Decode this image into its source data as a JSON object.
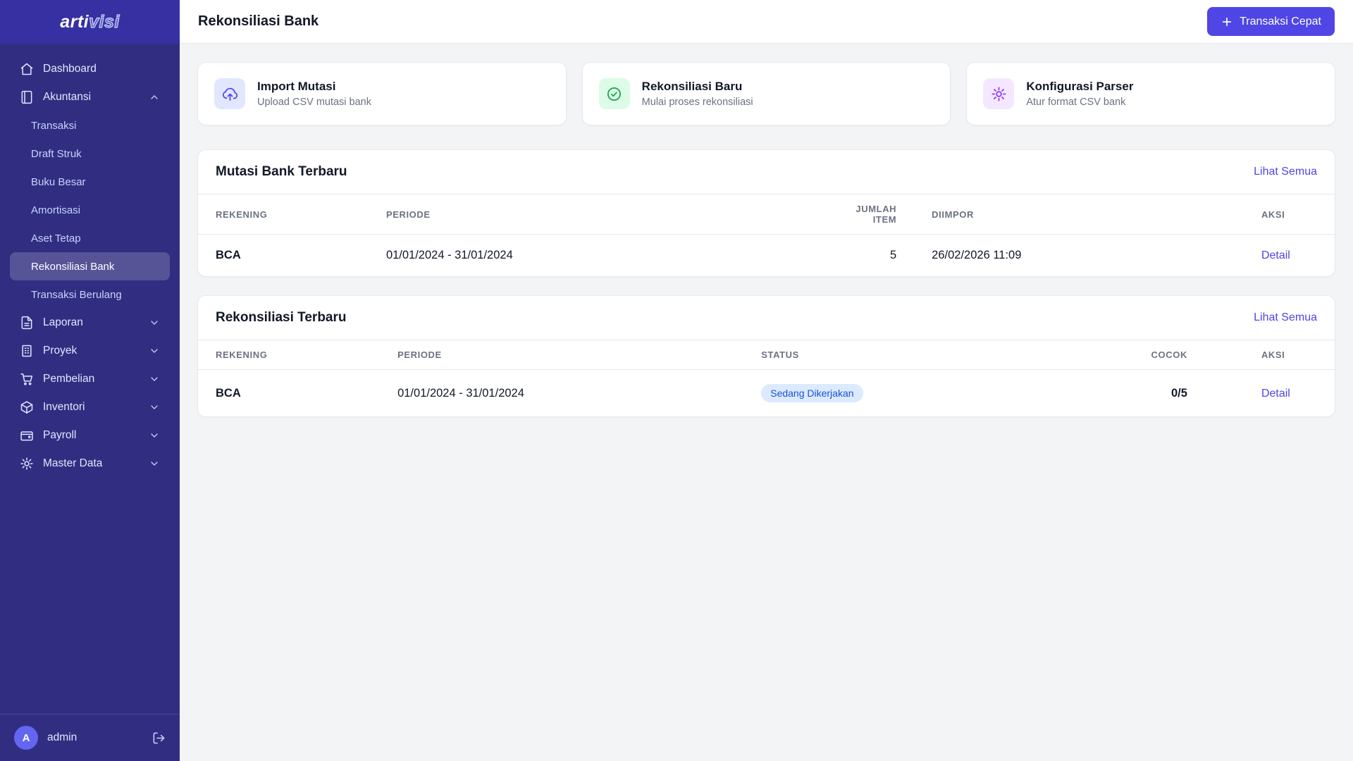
{
  "colors": {
    "sidebar_bg": "#312e81",
    "sidebar_top_bg": "#3730a3",
    "accent": "#4f46e5",
    "badge_bg": "#dbeafe",
    "badge_text": "#1d4ed8",
    "icon_indigo_bg": "#e0e7ff",
    "icon_green_bg": "#dcfce7",
    "icon_purple_bg": "#f3e8ff"
  },
  "sidebar": {
    "logo": {
      "prefix": "arti",
      "suffix": "visi"
    },
    "dashboard": "Dashboard",
    "akuntansi": "Akuntansi",
    "akuntansi_children": [
      "Transaksi",
      "Draft Struk",
      "Buku Besar",
      "Amortisasi",
      "Aset Tetap",
      "Rekonsiliasi Bank",
      "Transaksi Berulang"
    ],
    "groups": [
      "Laporan",
      "Proyek",
      "Pembelian",
      "Inventori",
      "Payroll",
      "Master Data"
    ],
    "user": {
      "initial": "A",
      "name": "admin"
    }
  },
  "header": {
    "title": "Rekonsiliasi Bank",
    "quick_action": "Transaksi Cepat"
  },
  "action_cards": [
    {
      "title": "Import Mutasi",
      "subtitle": "Upload CSV mutasi bank",
      "icon": "cloud-upload-icon"
    },
    {
      "title": "Rekonsiliasi Baru",
      "subtitle": "Mulai proses rekonsiliasi",
      "icon": "check-circle-icon"
    },
    {
      "title": "Konfigurasi Parser",
      "subtitle": "Atur format CSV bank",
      "icon": "gear-icon"
    }
  ],
  "mutasi": {
    "title": "Mutasi Bank Terbaru",
    "view_all": "Lihat Semua",
    "columns": [
      "Rekening",
      "Periode",
      "Jumlah Item",
      "Diimpor",
      "Aksi"
    ],
    "rows": [
      {
        "rekening": "BCA",
        "periode": "01/01/2024 - 31/01/2024",
        "jumlah_item": "5",
        "diimpor": "26/02/2026 11:09",
        "aksi": "Detail"
      }
    ]
  },
  "rekonsiliasi": {
    "title": "Rekonsiliasi Terbaru",
    "view_all": "Lihat Semua",
    "columns": [
      "Rekening",
      "Periode",
      "Status",
      "Cocok",
      "Aksi"
    ],
    "rows": [
      {
        "rekening": "BCA",
        "periode": "01/01/2024 - 31/01/2024",
        "status": "Sedang Dikerjakan",
        "cocok": "0/5",
        "aksi": "Detail"
      }
    ]
  }
}
